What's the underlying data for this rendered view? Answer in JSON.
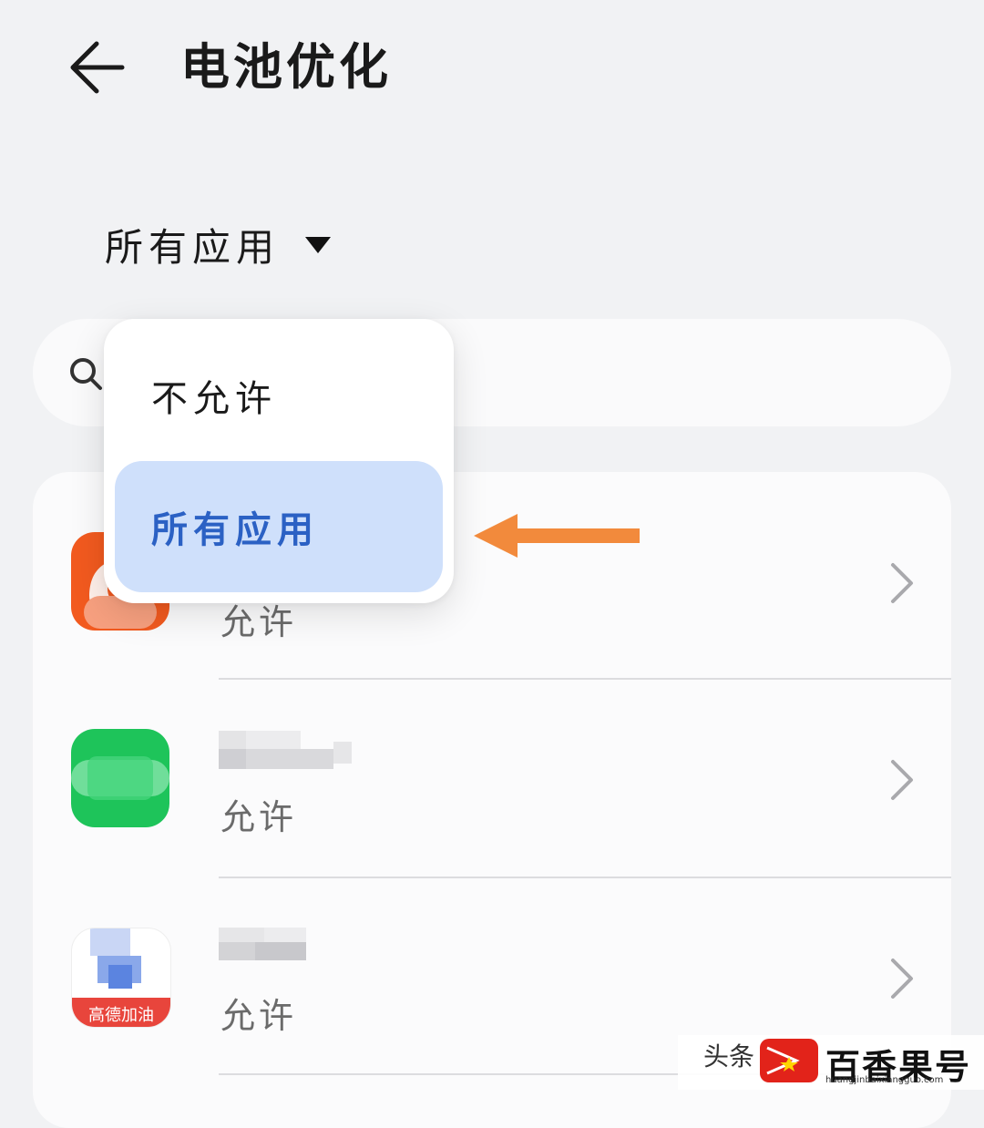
{
  "header": {
    "title": "电池优化"
  },
  "filter": {
    "selected_label": "所有应用"
  },
  "dropdown": {
    "options": [
      {
        "label": "不允许",
        "selected": false
      },
      {
        "label": "所有应用",
        "selected": true
      }
    ],
    "selected_color": "#2b61c4",
    "selected_bg": "#cfe0fb"
  },
  "apps": [
    {
      "status": "允许",
      "icon": "orange-app-icon",
      "color": "#f25a1f"
    },
    {
      "status": "允许",
      "icon": "green-app-icon",
      "color": "#1ec45a"
    },
    {
      "status": "允许",
      "icon": "gaode-app-icon",
      "color": "#e8453c"
    }
  ],
  "app3_icon_text": "高德加油",
  "annotation": {
    "icon": "orange-arrow-left",
    "color": "#f28a3c"
  },
  "watermark": {
    "prefix": "头条",
    "brand": "百香果号",
    "url": "huangjinbaixiangguo.com"
  }
}
